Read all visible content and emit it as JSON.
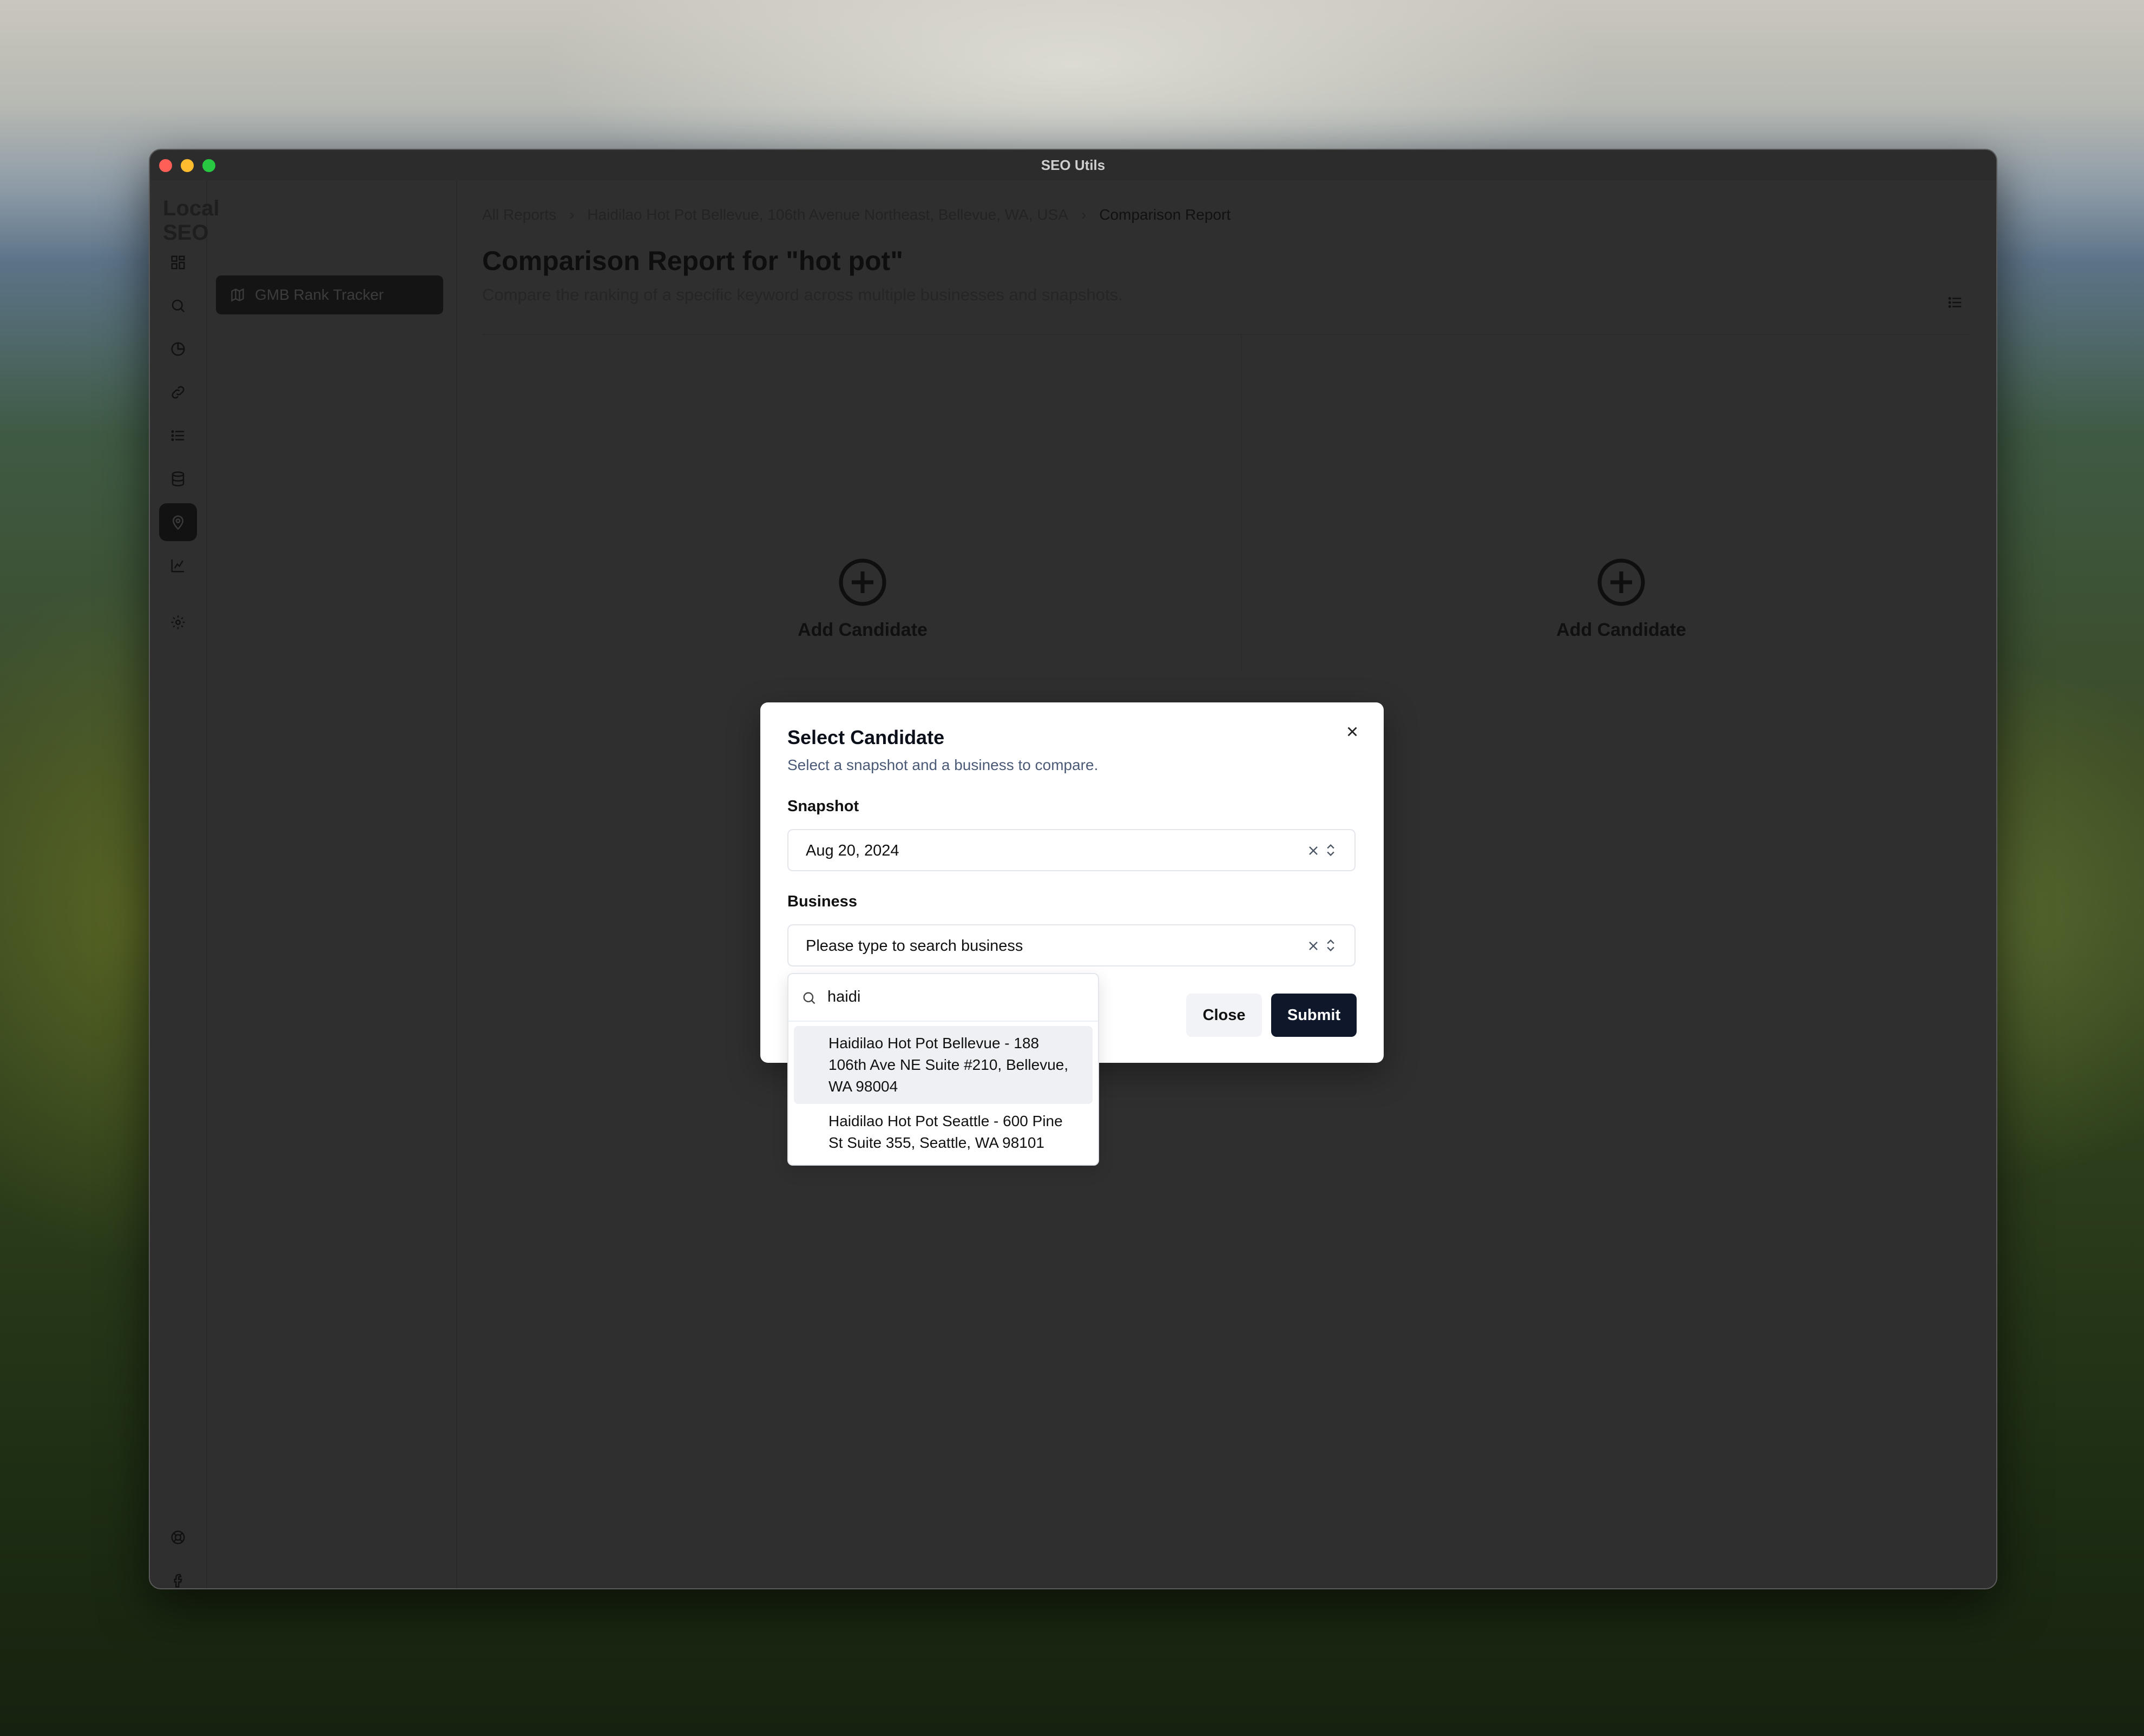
{
  "window": {
    "title": "SEO Utils"
  },
  "app": {
    "name": "Local SEO"
  },
  "rail": {
    "items": [
      {
        "icon": "dashboard-icon"
      },
      {
        "icon": "search-icon"
      },
      {
        "icon": "pie-chart-icon"
      },
      {
        "icon": "link-icon"
      },
      {
        "icon": "list-icon"
      },
      {
        "icon": "database-icon"
      },
      {
        "icon": "map-pin-icon",
        "active": true
      },
      {
        "icon": "chart-icon"
      },
      {
        "icon": "gear-icon"
      }
    ],
    "bottom": [
      {
        "icon": "lifebuoy-icon"
      },
      {
        "icon": "facebook-icon"
      },
      {
        "icon": "git-pull-request-icon"
      }
    ]
  },
  "subnav": {
    "items": [
      {
        "label": "GMB Rank Tracker",
        "icon": "map-icon"
      }
    ]
  },
  "breadcrumb": {
    "items": [
      "All Reports",
      "Haidilao Hot Pot Bellevue, 106th Avenue Northeast, Bellevue, WA, USA",
      "Comparison Report"
    ]
  },
  "page": {
    "title": "Comparison Report for \"hot pot\"",
    "subtitle": "Compare the ranking of a specific keyword across multiple businesses and snapshots."
  },
  "candidates": [
    {
      "label": "Add Candidate"
    },
    {
      "label": "Add Candidate"
    }
  ],
  "modal": {
    "title": "Select Candidate",
    "subtitle": "Select a snapshot and a business to compare.",
    "snapshot_label": "Snapshot",
    "snapshot_value": "Aug 20, 2024",
    "business_label": "Business",
    "business_placeholder": "Please type to search business",
    "close_label": "Close",
    "submit_label": "Submit"
  },
  "dropdown": {
    "query": "haidi",
    "options": [
      {
        "line1": "Haidilao Hot Pot Bellevue - 188",
        "line2": "106th Ave NE Suite #210, Bellevue,",
        "line3": "WA 98004",
        "highlighted": true
      },
      {
        "line1": "Haidilao Hot Pot Seattle - 600 Pine",
        "line2": "St Suite 355, Seattle, WA 98101",
        "highlighted": false
      }
    ]
  },
  "colors": {
    "accent": "#0f172a",
    "overlay": "#333333",
    "muted_text": "#4b5a76"
  }
}
